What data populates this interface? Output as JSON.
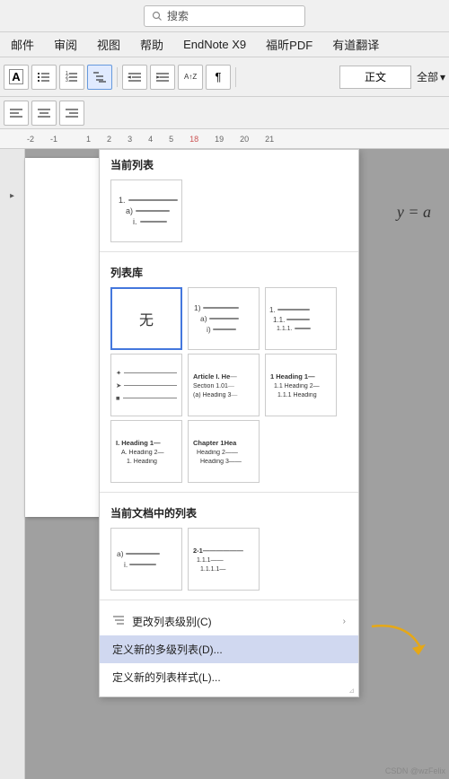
{
  "titlebar": {
    "search_placeholder": "搜索"
  },
  "menubar": {
    "items": [
      "邮件",
      "审阅",
      "视图",
      "帮助",
      "EndNote X9",
      "福昕PDF",
      "有道翻译"
    ]
  },
  "toolbar": {
    "style_label": "正文",
    "quanbu_label": "全部"
  },
  "ruler": {
    "marks": [
      "-2",
      "-1",
      "1",
      "2",
      "3"
    ]
  },
  "dropdown": {
    "section_current": "当前列表",
    "section_library": "列表库",
    "section_document": "当前文档中的列表",
    "wu_label": "无",
    "library_items": [
      {
        "id": "none",
        "label": "无",
        "type": "wu"
      },
      {
        "id": "numbered1",
        "label": "1) a) i)",
        "type": "numbered"
      },
      {
        "id": "numbered2",
        "label": "1. 1.1. 1.1.1.",
        "type": "numbered2"
      },
      {
        "id": "outline1",
        "label": "Article Section",
        "type": "outline_article"
      },
      {
        "id": "outline2",
        "label": "1 Heading",
        "type": "outline_heading1"
      },
      {
        "id": "outline3",
        "label": "I. Heading",
        "type": "outline_roman"
      },
      {
        "id": "outline4",
        "label": "Chapter Heading",
        "type": "outline_chapter"
      }
    ],
    "bottom_menus": [
      {
        "id": "change-level",
        "icon": "≡",
        "label": "更改列表级别(C)",
        "has_arrow": true
      },
      {
        "id": "define-new",
        "icon": "",
        "label": "定义新的多级列表(D)...",
        "highlighted": true
      },
      {
        "id": "define-style",
        "icon": "",
        "label": "定义新的列表样式(L)..."
      }
    ]
  },
  "formula": {
    "text": "y = a"
  },
  "watermark": {
    "text": "CSDN @wzFelix"
  }
}
